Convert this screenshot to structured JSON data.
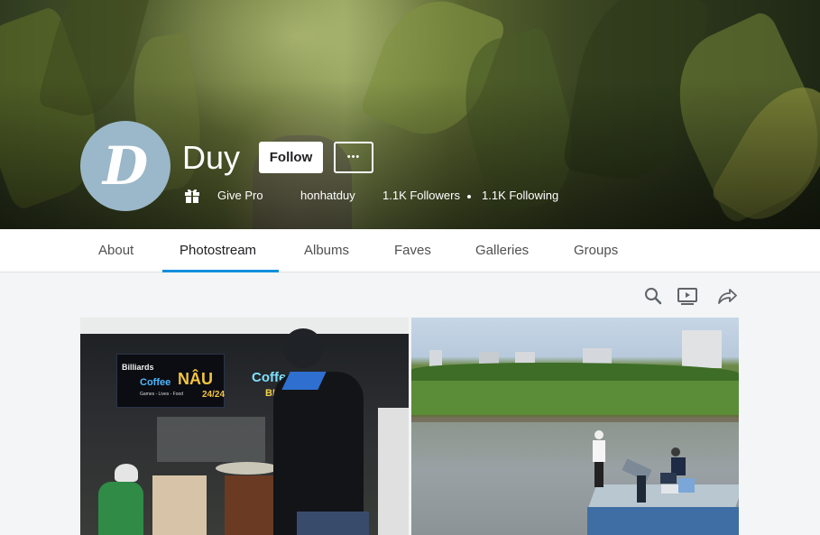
{
  "profile": {
    "name": "Duy",
    "avatar_letter": "D",
    "follow_label": "Follow",
    "more_label": "•••",
    "give_pro_label": "Give Pro",
    "username": "honhatduy",
    "followers": "1.1K Followers",
    "following": "1.1K Following"
  },
  "tabs": [
    {
      "label": "About"
    },
    {
      "label": "Photostream",
      "active": true
    },
    {
      "label": "Albums"
    },
    {
      "label": "Faves"
    },
    {
      "label": "Galleries"
    },
    {
      "label": "Groups"
    }
  ],
  "toolbar": {
    "icons": [
      "search-icon",
      "slideshow-icon",
      "share-icon"
    ]
  },
  "photos": {
    "photo1": {
      "sign_top": "Billiards",
      "sign_coffee": "Coffee",
      "sign_nau": "NÂU",
      "sign_hours": "24/24",
      "sign_small": "Games - Lives - Food",
      "sign_right_coffee": "Coffe",
      "sign_right_bida": "BIDA"
    }
  },
  "colors": {
    "accent": "#128fdc",
    "avatar_bg": "#9ab8c9",
    "page_bg": "#f3f5f6"
  }
}
